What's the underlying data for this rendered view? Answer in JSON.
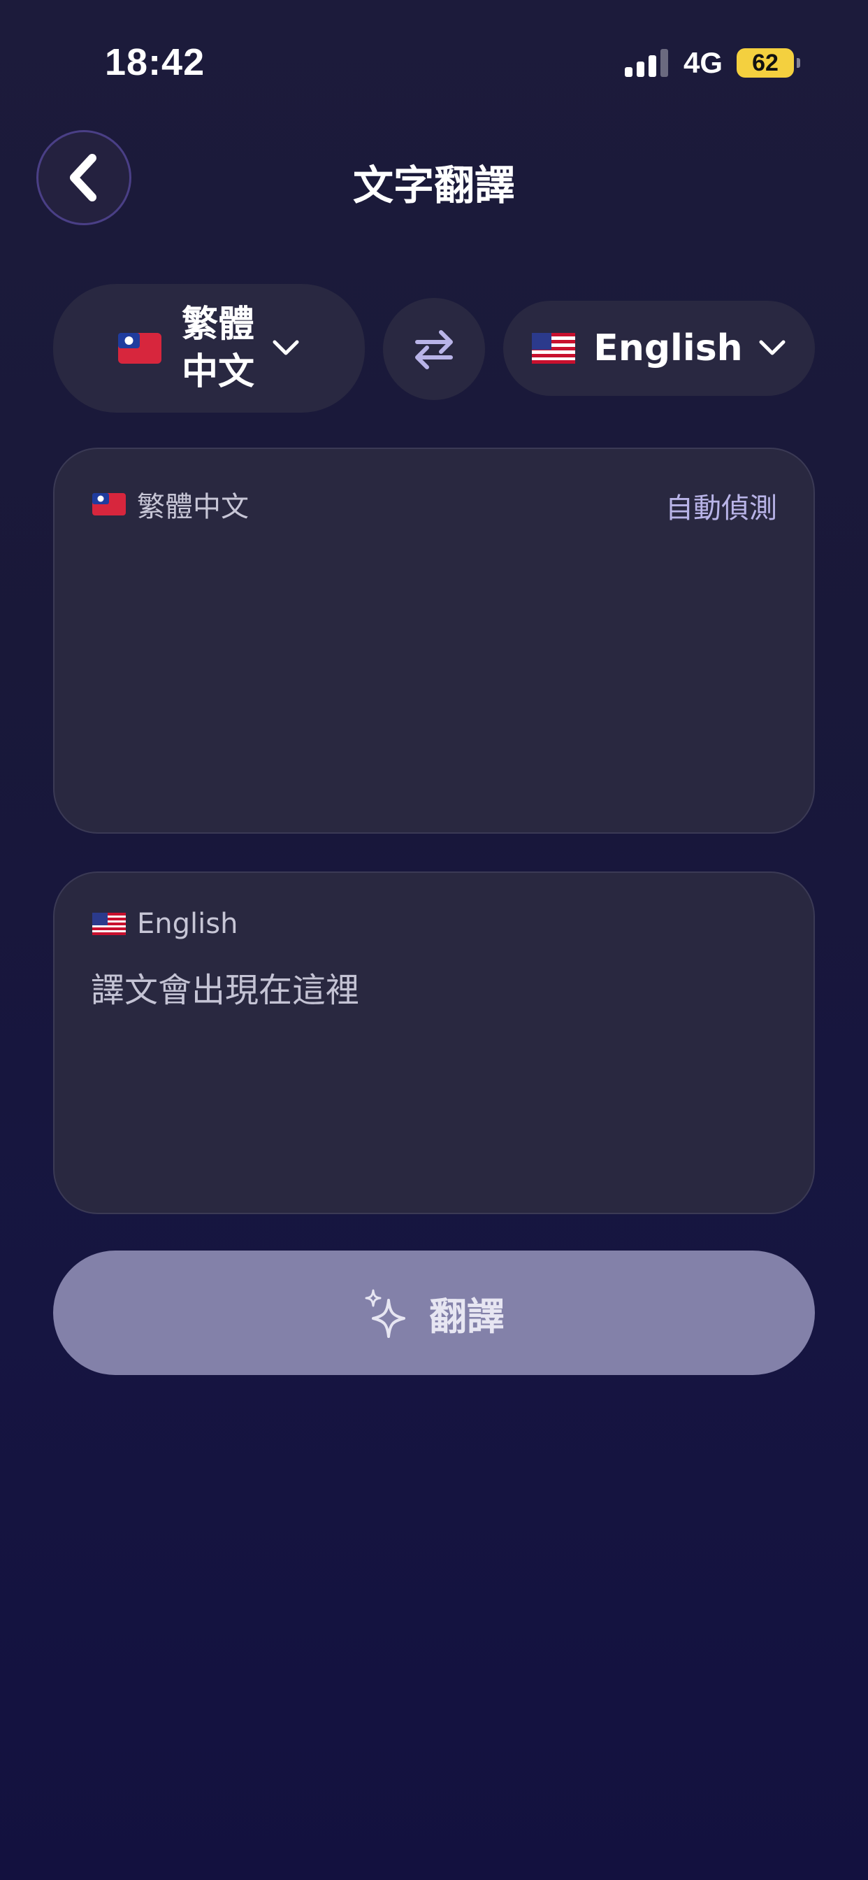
{
  "status_bar": {
    "time": "18:42",
    "network": "4G",
    "battery": "62",
    "battery_color": "#f4d03f"
  },
  "header": {
    "title": "文字翻譯",
    "back_icon": "chevron-left-icon"
  },
  "languages": {
    "source": {
      "flag": "taiwan-flag-icon",
      "name_line1": "繁體",
      "name_line2": "中文"
    },
    "target": {
      "flag": "us-flag-icon",
      "name": "English"
    },
    "swap_icon": "swap-arrows-icon"
  },
  "source_card": {
    "language": "繁體中文",
    "auto_detect": "自動偵測",
    "input_value": ""
  },
  "target_card": {
    "language": "English",
    "placeholder": "譯文會出現在這裡"
  },
  "translate_button": {
    "icon": "sparkles-icon",
    "label": "翻譯"
  },
  "colors": {
    "background": "#1a1939",
    "card": "#292840",
    "accent": "#b9b4e8",
    "button": "#8381a9"
  }
}
